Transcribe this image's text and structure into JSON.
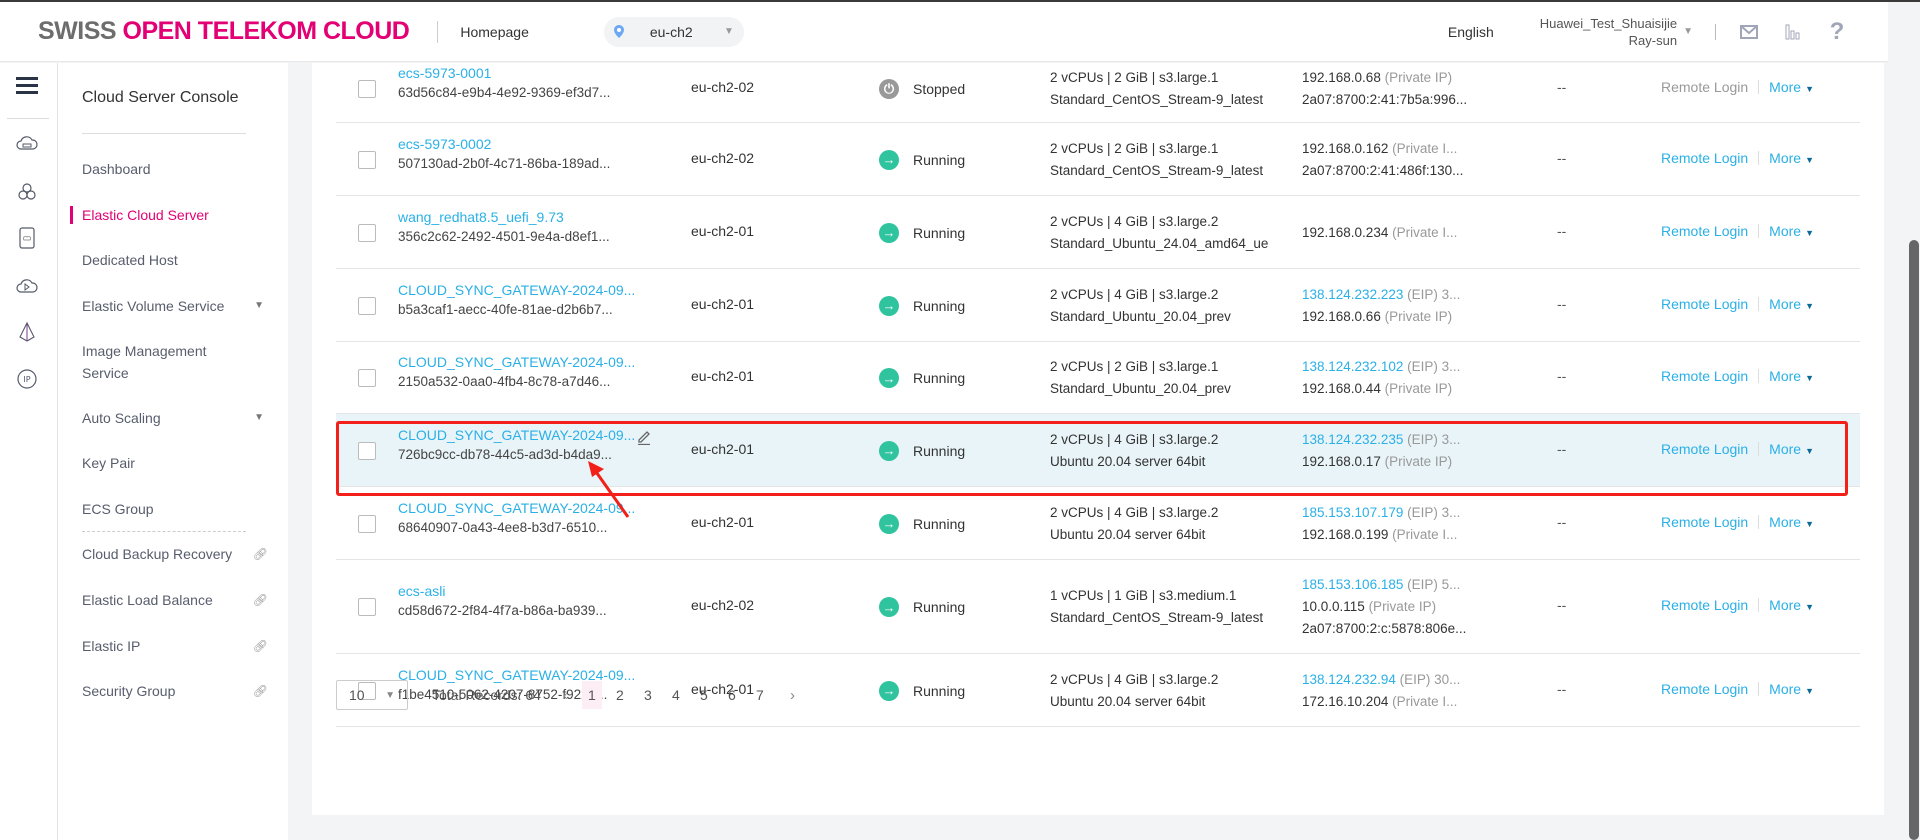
{
  "header": {
    "logo_part1": "SWISS ",
    "logo_part2": "OPEN TELEKOM CLOUD",
    "homepage": "Homepage",
    "region": "eu-ch2",
    "language": "English",
    "user_line1": "Huawei_Test_Shuaisijie",
    "user_line2": "Ray-sun",
    "icons": [
      "mail-icon",
      "chart-icon",
      "help-icon"
    ],
    "help_glyph": "?"
  },
  "rail": {
    "icons": [
      "menu-icon",
      "cloud-server-icon",
      "hexagon-cluster-icon",
      "storage-device-icon",
      "cloud-play-icon",
      "network-pyramid-icon",
      "ip-icon"
    ]
  },
  "sidebar": {
    "title": "Cloud Server Console",
    "items": [
      {
        "label": "Dashboard",
        "active": false
      },
      {
        "label": "Elastic Cloud Server",
        "active": true
      },
      {
        "label": "Dedicated Host",
        "active": false
      },
      {
        "label": "Elastic Volume Service",
        "expandable": true
      },
      {
        "label": "Image Management Service"
      },
      {
        "label": "Auto Scaling",
        "expandable": true
      },
      {
        "label": "Key Pair"
      },
      {
        "label": "ECS Group"
      },
      {
        "label": "Cloud Backup Recovery",
        "external": true
      },
      {
        "label": "Elastic Load Balance",
        "external": true
      },
      {
        "label": "Elastic IP",
        "external": true
      },
      {
        "label": "Security Group",
        "external": true
      }
    ]
  },
  "table": {
    "rows": [
      {
        "name": "ecs-5973-0001",
        "id": "63d56c84-e9b4-4e92-9369-ef3d7...",
        "az": "eu-ch2-02",
        "status": "Stopped",
        "spec": "2 vCPUs | 2 GiB | s3.large.1",
        "image": "Standard_CentOS_Stream-9_latest",
        "ip": [
          {
            "v": "192.168.0.68",
            "t": " (Private IP)"
          },
          {
            "v": "2a07:8700:2:41:7b5a:996...",
            "t": ""
          }
        ],
        "billing": "--",
        "remote_login": "Remote Login",
        "more": "More",
        "remote_disabled": true
      },
      {
        "name": "ecs-5973-0002",
        "id": "507130ad-2b0f-4c71-86ba-189ad...",
        "az": "eu-ch2-02",
        "status": "Running",
        "spec": "2 vCPUs | 2 GiB | s3.large.1",
        "image": "Standard_CentOS_Stream-9_latest",
        "ip": [
          {
            "v": "192.168.0.162",
            "t": " (Private I..."
          },
          {
            "v": "2a07:8700:2:41:486f:130...",
            "t": ""
          }
        ],
        "billing": "--",
        "remote_login": "Remote Login",
        "more": "More"
      },
      {
        "name": "wang_redhat8.5_uefi_9.73",
        "id": "356c2c62-2492-4501-9e4a-d8ef1...",
        "az": "eu-ch2-01",
        "status": "Running",
        "spec": "2 vCPUs | 4 GiB | s3.large.2",
        "image": "Standard_Ubuntu_24.04_amd64_ue",
        "ip": [
          {
            "v": "192.168.0.234",
            "t": " (Private I..."
          }
        ],
        "billing": "--",
        "remote_login": "Remote Login",
        "more": "More"
      },
      {
        "name": "CLOUD_SYNC_GATEWAY-2024-09...",
        "id": "b5a3caf1-aecc-40fe-81ae-d2b6b7...",
        "az": "eu-ch2-01",
        "status": "Running",
        "spec": "2 vCPUs | 4 GiB | s3.large.2",
        "image": "Standard_Ubuntu_20.04_prev",
        "ip": [
          {
            "eip": "138.124.232.223",
            "t": " (EIP)  3..."
          },
          {
            "v": "192.168.0.66",
            "t": " (Private IP)"
          }
        ],
        "billing": "--",
        "remote_login": "Remote Login",
        "more": "More"
      },
      {
        "name": "CLOUD_SYNC_GATEWAY-2024-09...",
        "id": "2150a532-0aa0-4fb4-8c78-a7d46...",
        "az": "eu-ch2-01",
        "status": "Running",
        "spec": "2 vCPUs | 2 GiB | s3.large.1",
        "image": "Standard_Ubuntu_20.04_prev",
        "ip": [
          {
            "eip": "138.124.232.102",
            "t": " (EIP)  3..."
          },
          {
            "v": "192.168.0.44",
            "t": " (Private IP)"
          }
        ],
        "billing": "--",
        "remote_login": "Remote Login",
        "more": "More"
      },
      {
        "name": "CLOUD_SYNC_GATEWAY-2024-09...",
        "id": "726bc9cc-db78-44c5-ad3d-b4da9...",
        "az": "eu-ch2-01",
        "status": "Running",
        "spec": "2 vCPUs | 4 GiB | s3.large.2",
        "image": "Ubuntu 20.04 server 64bit",
        "ip": [
          {
            "eip": "138.124.232.235",
            "t": " (EIP)  3..."
          },
          {
            "v": "192.168.0.17",
            "t": " (Private IP)"
          }
        ],
        "billing": "--",
        "remote_login": "Remote Login",
        "more": "More",
        "highlighted": true
      },
      {
        "name": "CLOUD_SYNC_GATEWAY-2024-09...",
        "id": "68640907-0a43-4ee8-b3d7-6510...",
        "az": "eu-ch2-01",
        "status": "Running",
        "spec": "2 vCPUs | 4 GiB | s3.large.2",
        "image": "Ubuntu 20.04 server 64bit",
        "ip": [
          {
            "eip": "185.153.107.179",
            "t": " (EIP)  3..."
          },
          {
            "v": "192.168.0.199",
            "t": " (Private I..."
          }
        ],
        "billing": "--",
        "remote_login": "Remote Login",
        "more": "More"
      },
      {
        "name": "ecs-asli",
        "id": "cd58d672-2f84-4f7a-b86a-ba939...",
        "az": "eu-ch2-02",
        "status": "Running",
        "spec": "1 vCPUs | 1 GiB | s3.medium.1",
        "image": "Standard_CentOS_Stream-9_latest",
        "ip": [
          {
            "eip": "185.153.106.185",
            "t": " (EIP)  5..."
          },
          {
            "v": "10.0.0.115",
            "t": " (Private IP)"
          },
          {
            "v": "2a07:8700:2:c:5878:806e...",
            "t": ""
          }
        ],
        "billing": "--",
        "remote_login": "Remote Login",
        "more": "More"
      },
      {
        "name": "CLOUD_SYNC_GATEWAY-2024-09...",
        "id": "f1be4510-5062-4207-8752-f9220...",
        "az": "eu-ch2-01",
        "status": "Running",
        "spec": "2 vCPUs | 4 GiB | s3.large.2",
        "image": "Ubuntu 20.04 server 64bit",
        "ip": [
          {
            "eip": "138.124.232.94",
            "t": " (EIP)  30..."
          },
          {
            "v": "172.16.10.204",
            "t": " (Private I..."
          }
        ],
        "billing": "--",
        "remote_login": "Remote Login",
        "more": "More"
      }
    ]
  },
  "pagination": {
    "page_size": "10",
    "total": "Total Records: 64",
    "pages": [
      "1",
      "2",
      "3",
      "4",
      "5",
      "6",
      "7"
    ],
    "current": "1",
    "prev": "‹",
    "next": "›"
  },
  "colors": {
    "brand": "#e20074",
    "link": "#2ab0e6",
    "running": "#2fc49e",
    "stopped": "#999999",
    "highlight_border": "#f22018"
  }
}
